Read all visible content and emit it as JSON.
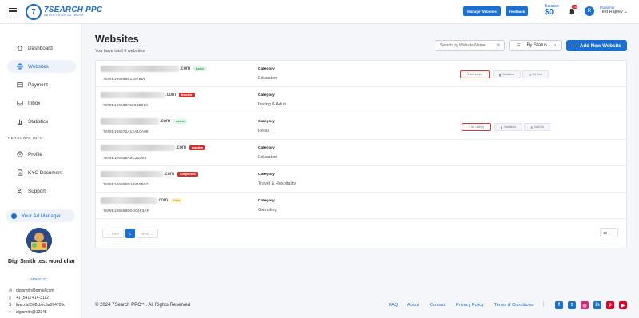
{
  "header": {
    "brand": "7SEARCH PPC",
    "brand_sub": "ADVERTISING NETWORK",
    "manage_websites_label": "Manage Websites",
    "feedback_label": "Feedback",
    "balance_label": "Balance",
    "balance_value": "$0",
    "notifications_count": "24",
    "avatar_initial": "R",
    "user_role": "Publisher",
    "user_name": "Test Rajeev"
  },
  "sidebar": {
    "items": [
      {
        "label": "Dashboard",
        "icon": "home-icon"
      },
      {
        "label": "Websites",
        "icon": "globe-icon"
      },
      {
        "label": "Payment",
        "icon": "wallet-icon"
      },
      {
        "label": "Inbox",
        "icon": "inbox-icon"
      },
      {
        "label": "Statistics",
        "icon": "bar-chart-icon"
      }
    ],
    "personal_info_label": "PERSONAL INFO",
    "personal_items": [
      {
        "label": "Profile",
        "icon": "user-icon"
      },
      {
        "label": "KYC Document",
        "icon": "document-icon"
      },
      {
        "label": "Support",
        "icon": "support-icon"
      }
    ],
    "ad_manager_label": "Your Ad Manager",
    "ad_manager_name": "Digi Smith test word char",
    "ad_manager_code": "ADM5337",
    "contacts": [
      {
        "icon": "mail-icon",
        "value": "digismith@gmail.com"
      },
      {
        "icon": "phone-icon",
        "value": "+1 (541) 414-3112"
      },
      {
        "icon": "skype-icon",
        "value": "live:.cid.502cbec5a094709c"
      },
      {
        "icon": "telegram-icon",
        "value": "digismith@12345"
      }
    ]
  },
  "main": {
    "title": "Websites",
    "subtitle": "You have total 6 websites",
    "search_placeholder": "Search by Website Name",
    "status_filter_label": "By Status",
    "add_button_label": "Add New Website",
    "category_label": "Category",
    "websites": [
      {
        "domain_suffix": ".com",
        "status": "Active",
        "status_class": "active",
        "site_id": "7SWB106698E1287B06",
        "category": "Education",
        "ad_units_label": "3 ad unit(s)",
        "statistics_label": "Statistics",
        "ad_unit_label": "Ad Unit"
      },
      {
        "domain_suffix": ".com",
        "status": "Inactive",
        "status_class": "inactive",
        "site_id": "7SWB106688F0298D018",
        "category": "Dating & Adult"
      },
      {
        "domain_suffix": ".com",
        "status": "Active",
        "status_class": "active",
        "site_id": "7SWB106672A12A10A08",
        "category": "Retail",
        "ad_units_label": "3 ad unit(s)",
        "statistics_label": "Statistics",
        "ad_unit_label": "Ad Unit"
      },
      {
        "domain_suffix": ".com",
        "status": "Inactive",
        "status_class": "inactive",
        "site_id": "7SWB106668A9C22D03",
        "category": "Education"
      },
      {
        "domain_suffix": ".com",
        "status": "Suspended",
        "status_class": "suspended",
        "site_id": "7SWB106658D10840B07",
        "category": "Travel & Hospitality"
      },
      {
        "domain_suffix": ".com",
        "status": "Hold",
        "status_class": "hold",
        "site_id": "7SWB106658D0D04F3AF",
        "category": "Gambling"
      }
    ],
    "pagination": {
      "prev": "← Prev",
      "current": "1",
      "next": "Next →",
      "per_page": "10"
    }
  },
  "footer": {
    "copyright": "© 2024 7Search PPC™. All Rights Reserved",
    "links": [
      "FAQ",
      "About",
      "Contact",
      "Privacy Policy",
      "Terms & Conditions"
    ],
    "social": [
      {
        "icon": "facebook-icon",
        "glyph": "f",
        "color": "#1b6fd1"
      },
      {
        "icon": "twitter-icon",
        "glyph": "t",
        "color": "#1b6fd1"
      },
      {
        "icon": "instagram-icon",
        "glyph": "◎",
        "color": "#d62976"
      },
      {
        "icon": "linkedin-icon",
        "glyph": "in",
        "color": "#1b6fd1"
      },
      {
        "icon": "pinterest-icon",
        "glyph": "p",
        "color": "#e60023"
      },
      {
        "icon": "youtube-icon",
        "glyph": "▶",
        "color": "#e60023"
      }
    ]
  }
}
